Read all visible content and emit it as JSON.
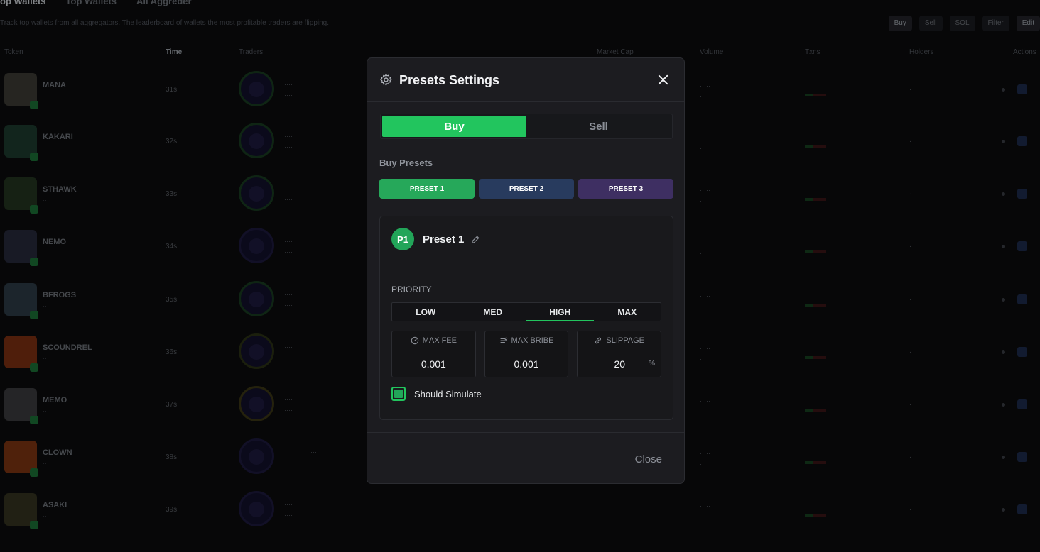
{
  "background": {
    "nav_tabs": [
      "op Wallets",
      "Top Wallets",
      "All Aggreder"
    ],
    "subtext": "Track top wallets from all aggregators. The leaderboard of wallets the most profitable traders are flipping.",
    "controls": [
      "Buy",
      "Sell",
      "SOL",
      "Filter",
      "Edit"
    ],
    "columns": [
      "Token",
      "Time",
      "Traders",
      "Market Cap",
      "Volume",
      "Txns",
      "Holders",
      "Actions"
    ],
    "rows": [
      {
        "name": "MANA",
        "age": "31s"
      },
      {
        "name": "KAKARI",
        "age": "32s"
      },
      {
        "name": "STHAWK",
        "age": "33s"
      },
      {
        "name": "NEMO",
        "age": "34s"
      },
      {
        "name": "BFROGS",
        "age": "35s"
      },
      {
        "name": "SCOUNDREL",
        "age": "36s"
      },
      {
        "name": "MEMO",
        "age": "37s"
      },
      {
        "name": "CLOWN",
        "age": "38s"
      },
      {
        "name": "ASAKI",
        "age": "39s"
      }
    ]
  },
  "modal": {
    "title": "Presets Settings",
    "icons": {
      "header": "gear-icon",
      "close": "close-icon",
      "edit": "pencil-icon"
    },
    "tabs": {
      "buy": "Buy",
      "sell": "Sell",
      "active": "buy"
    },
    "presets_label": "Buy Presets",
    "presets": [
      "PRESET 1",
      "PRESET 2",
      "PRESET 3"
    ],
    "preset_colors": {
      "preset1": "#26a85a",
      "preset2": "#283b5e",
      "preset3": "#3e2f62"
    },
    "card": {
      "badge": "P1",
      "name": "Preset 1",
      "priority_label": "PRIORITY",
      "priority_options": [
        "LOW",
        "MED",
        "HIGH",
        "MAX"
      ],
      "priority_selected": "HIGH",
      "fields": {
        "max_fee": {
          "label": "MAX FEE",
          "value": "0.001"
        },
        "max_bribe": {
          "label": "MAX BRIBE",
          "value": "0.001"
        },
        "slippage": {
          "label": "SLIPPAGE",
          "value": "20",
          "unit": "%"
        }
      },
      "should_simulate": {
        "label": "Should Simulate",
        "checked": true
      }
    },
    "footer": {
      "close_label": "Close"
    },
    "accent_color": "#22c55e"
  }
}
